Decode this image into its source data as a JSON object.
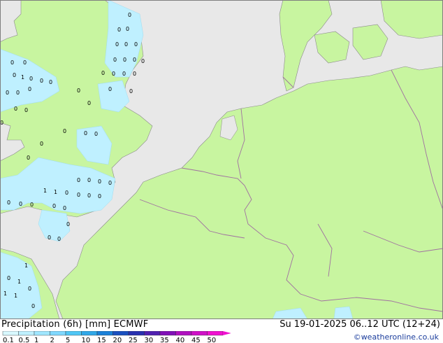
{
  "map": {
    "sea_color": "#e8e8e8",
    "land_color": "#c8f5a0",
    "border_color": "#a070a0",
    "precip_color_light": "#bff0ff"
  },
  "footer": {
    "title": "Precipitation (6h) [mm] ECMWF",
    "datetime": "Su 19-01-2025 06..12 UTC (12+24)",
    "copyright": "©weatheronline.co.uk"
  },
  "legend": {
    "labels": [
      "0.1",
      "0.5",
      "1",
      "2",
      "5",
      "10",
      "15",
      "20",
      "25",
      "30",
      "35",
      "40",
      "45",
      "50"
    ],
    "colors": [
      "#d8f8ff",
      "#bff0ff",
      "#a0e6ff",
      "#7fd8ff",
      "#4fc6f5",
      "#30a8e8",
      "#1a80d8",
      "#1a50c0",
      "#2830b0",
      "#5020b0",
      "#8010b8",
      "#b010c0",
      "#d010c8",
      "#f010d0"
    ]
  }
}
